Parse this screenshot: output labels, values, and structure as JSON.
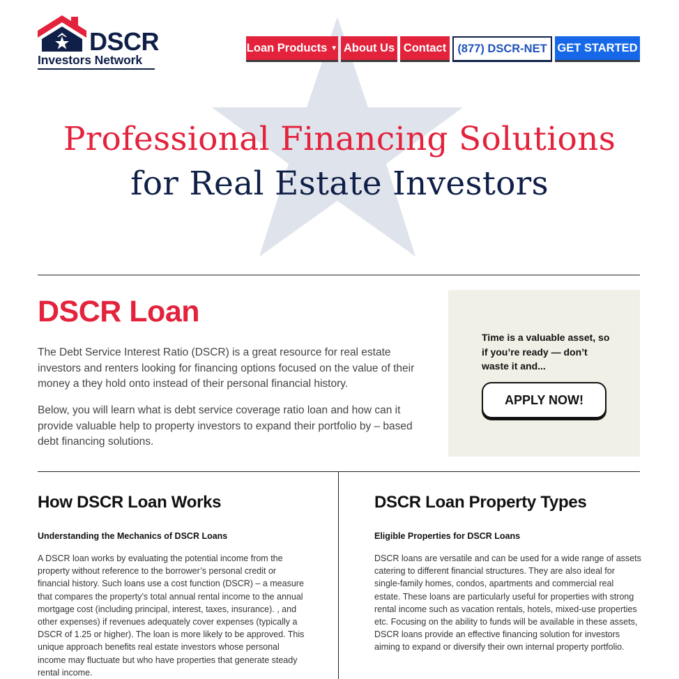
{
  "brand": {
    "name": "DSCR",
    "tagline": "Investors Network",
    "colors": {
      "red": "#e3223c",
      "navy": "#0f1f47",
      "blue": "#1668e8",
      "cta_bg": "#f0f0e6",
      "star": "#dfe3ec"
    }
  },
  "nav": {
    "loan_products": "Loan Products",
    "about_us": "About Us",
    "contact": "Contact",
    "phone": "(877) DSCR-NET",
    "get_started": "GET STARTED"
  },
  "hero": {
    "line1": "Professional Financing Solutions",
    "line2": "for Real Estate Investors"
  },
  "intro": {
    "title": "DSCR Loan",
    "p1": "The Debt Service Interest Ratio (DSCR) is a great resource for real estate investors and renters looking for financing options focused on the value of their money a they hold onto instead of their personal financial history.",
    "p2": "Below, you will learn what is debt service coverage ratio loan and how can it provide valuable help to property investors to expand their portfolio by – based debt financing solutions."
  },
  "cta": {
    "text": "Time is a valuable asset, so if you’re ready — don’t waste it and...",
    "button": "APPLY NOW!"
  },
  "sections": {
    "left": {
      "title": "How DSCR Loan Works",
      "subtitle": "Understanding the Mechanics of DSCR Loans",
      "body": "A DSCR loan works by evaluating the potential income from the property without reference to the borrower’s personal credit or financial history. Such loans use a cost function (DSCR) – a measure that compares the property’s total annual rental income to the annual mortgage cost (including principal, interest, taxes, insurance). , and other expenses) if revenues adequately cover expenses (typically a DSCR of 1.25 or higher). The loan is more likely to be approved. This unique approach benefits real estate investors whose personal income may fluctuate but who have properties that generate steady rental income."
    },
    "right": {
      "title": "DSCR Loan Property Types",
      "subtitle": "Eligible Properties for DSCR Loans",
      "body": "DSCR loans are versatile and can be used for a wide range of assets catering to different financial structures. They are also ideal for single-family homes, condos, apartments and commercial real estate. These loans are particularly useful for properties with strong rental income such as vacation rentals, hotels, mixed-use properties etc. Focusing on the ability to funds will be available in these assets, DSCR loans provide an effective financing solution for investors aiming to expand or diversify their own internal property portfolio."
    }
  }
}
